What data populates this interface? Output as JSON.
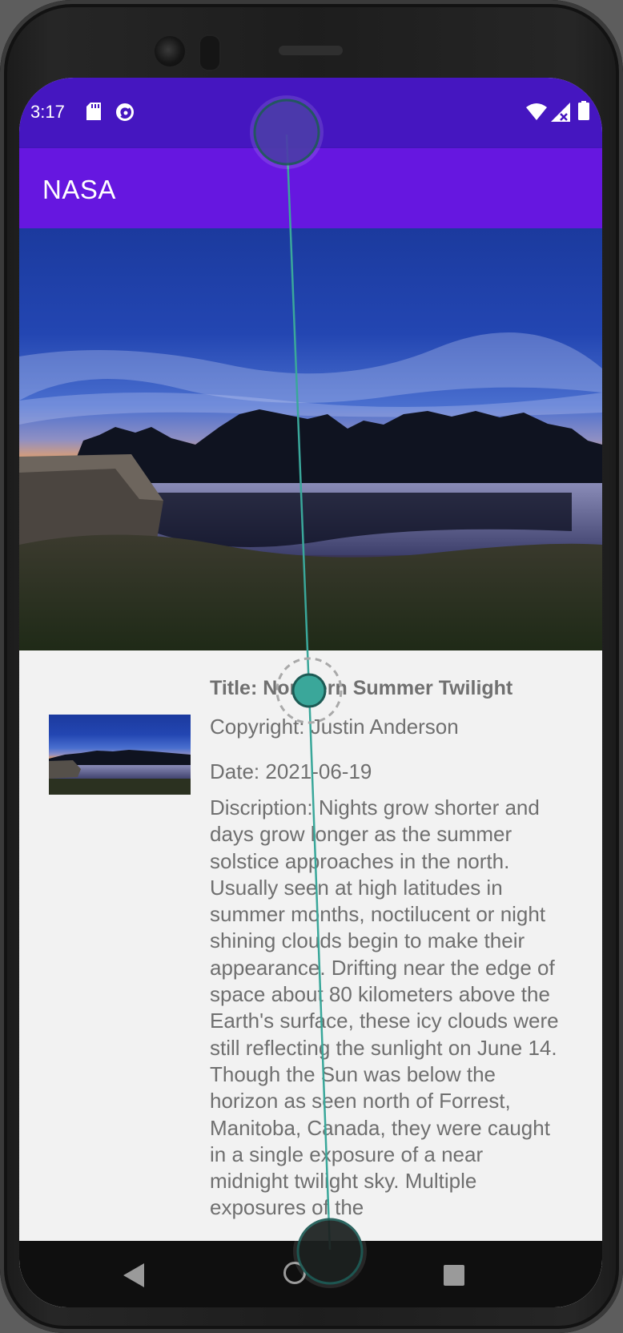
{
  "status_bar": {
    "time": "3:17",
    "icons": [
      "sd-card-icon",
      "cast-icon",
      "wifi-icon",
      "signal-icon",
      "battery-icon"
    ]
  },
  "app_bar": {
    "title": "NASA"
  },
  "apod": {
    "title": "Title: Northern Summer Twilight",
    "copyright": "Copyright: Justin Anderson",
    "date": "Date: 2021-06-19",
    "description": "Discription: Nights grow shorter and days grow longer as the summer solstice approaches in the north. Usually seen at high latitudes in summer months, noctilucent or night shining clouds begin to make their appearance. Drifting near the edge of space about 80 kilometers above the Earth's surface, these icy clouds were still reflecting the sunlight on June 14. Though the Sun was below the horizon as seen north of Forrest, Manitoba, Canada, they were caught in a single exposure of a near midnight twilight sky. Multiple exposures of the"
  },
  "nav_bar": {
    "icons": [
      "back-icon",
      "home-icon",
      "recents-icon"
    ]
  },
  "colors": {
    "status_bar": "#4516c0",
    "app_bar": "#6617e0",
    "content_bg": "#f2f2f2",
    "text": "#6f6f6f",
    "touch_marker": "#2a9d8f"
  }
}
